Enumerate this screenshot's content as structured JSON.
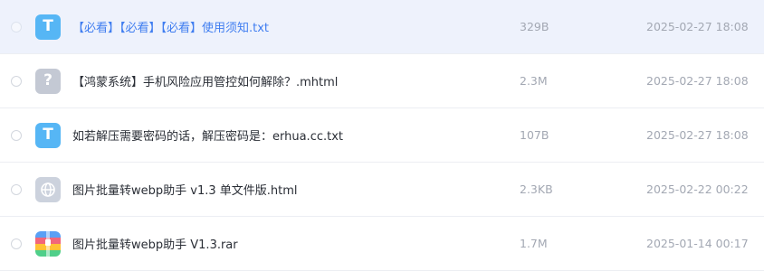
{
  "files": [
    {
      "name": "【必看】【必看】【必看】使用须知.txt",
      "size": "329B",
      "date": "2025-02-27 18:08",
      "icon": "txt-file-icon",
      "icon_glyph": "T",
      "selected": true
    },
    {
      "name": "【鸿蒙系统】手机风险应用管控如何解除？.mhtml",
      "size": "2.3M",
      "date": "2025-02-27 18:08",
      "icon": "unknown-file-icon",
      "icon_glyph": "?",
      "selected": false
    },
    {
      "name": "如若解压需要密码的话，解压密码是：erhua.cc.txt",
      "size": "107B",
      "date": "2025-02-27 18:08",
      "icon": "txt-file-icon",
      "icon_glyph": "T",
      "selected": false
    },
    {
      "name": "图片批量转webp助手 v1.3 单文件版.html",
      "size": "2.3KB",
      "date": "2025-02-22 00:22",
      "icon": "html-file-icon",
      "selected": false
    },
    {
      "name": "图片批量转webp助手 V1.3.rar",
      "size": "1.7M",
      "date": "2025-01-14 00:17",
      "icon": "rar-archive-icon",
      "selected": false
    }
  ],
  "colors": {
    "accent": "#3f7df0",
    "selected_row": "#eef2fc",
    "txt_icon": "#56b6f5",
    "muted_text": "#a3a8b3"
  }
}
